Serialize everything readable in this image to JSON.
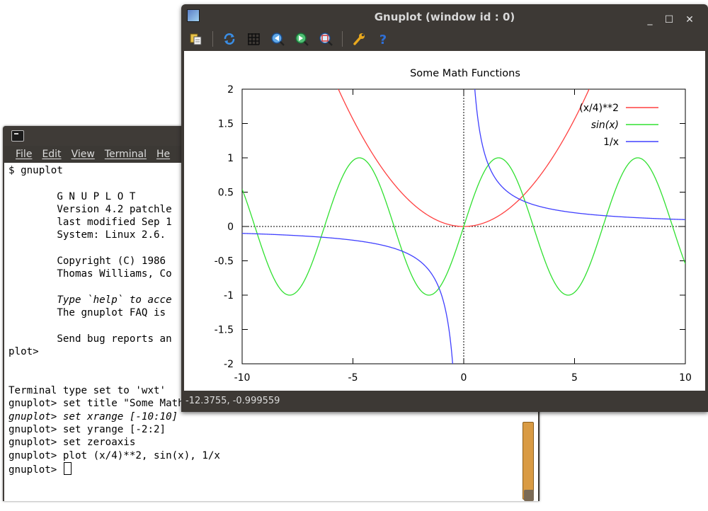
{
  "terminal": {
    "menu": [
      "File",
      "Edit",
      "View",
      "Terminal",
      "He"
    ],
    "lines": [
      {
        "text": "$ gnuplot",
        "italic": false
      },
      {
        "text": "",
        "italic": false
      },
      {
        "text": "        G N U P L O T",
        "italic": false
      },
      {
        "text": "        Version 4.2 patchle",
        "italic": false
      },
      {
        "text": "        last modified Sep 1",
        "italic": false
      },
      {
        "text": "        System: Linux 2.6.",
        "italic": false
      },
      {
        "text": "",
        "italic": false
      },
      {
        "text": "        Copyright (C) 1986",
        "italic": false
      },
      {
        "text": "        Thomas Williams, Co",
        "italic": false
      },
      {
        "text": "",
        "italic": false
      },
      {
        "text": "        Type `help` to acce",
        "italic": true
      },
      {
        "text": "        The gnuplot FAQ is",
        "italic": false
      },
      {
        "text": "",
        "italic": false
      },
      {
        "text": "        Send bug reports an",
        "italic": false
      },
      {
        "text": "plot>",
        "italic": false
      },
      {
        "text": "",
        "italic": false
      },
      {
        "text": "",
        "italic": false
      },
      {
        "text": "Terminal type set to 'wxt'",
        "italic": false
      },
      {
        "text": "gnuplot> set title \"Some Math Functions\"",
        "italic": false
      },
      {
        "text": "gnuplot> set xrange [-10:10]",
        "italic": true
      },
      {
        "text": "gnuplot> set yrange [-2:2]",
        "italic": false
      },
      {
        "text": "gnuplot> set zeroaxis",
        "italic": false
      },
      {
        "text": "gnuplot> plot (x/4)**2, sin(x), 1/x",
        "italic": false
      }
    ],
    "prompt": "gnuplot> "
  },
  "gnuplot_window": {
    "title": "Gnuplot (window id : 0)",
    "status": "-12.3755, -0.999559",
    "controls": {
      "minimize": "_",
      "maximize": "☐",
      "close": "✕"
    },
    "toolbar_icons": [
      "copy-to-clipboard-icon",
      "replot-icon",
      "grid-icon",
      "zoom-previous-icon",
      "zoom-next-icon",
      "autoscale-icon",
      "options-icon",
      "help-icon"
    ]
  },
  "chart_data": {
    "type": "line",
    "title": "Some Math Functions",
    "xlabel": "",
    "ylabel": "",
    "xlim": [
      -10,
      10
    ],
    "ylim": [
      -2,
      2
    ],
    "xticks": [
      -10,
      -5,
      0,
      5,
      10
    ],
    "yticks": [
      2,
      1.5,
      1,
      0.5,
      0,
      -0.5,
      -1,
      -1.5,
      -2
    ],
    "zeroaxis": true,
    "legend_position": "top-right",
    "series": [
      {
        "name": "(x/4)**2",
        "expr": "(x/4)**2",
        "color": "#ff4040",
        "italic": false
      },
      {
        "name": "sin(x)",
        "expr": "sin(x)",
        "color": "#30e030",
        "italic": true
      },
      {
        "name": "1/x",
        "expr": "1/x",
        "color": "#4040ff",
        "italic": false
      }
    ]
  }
}
